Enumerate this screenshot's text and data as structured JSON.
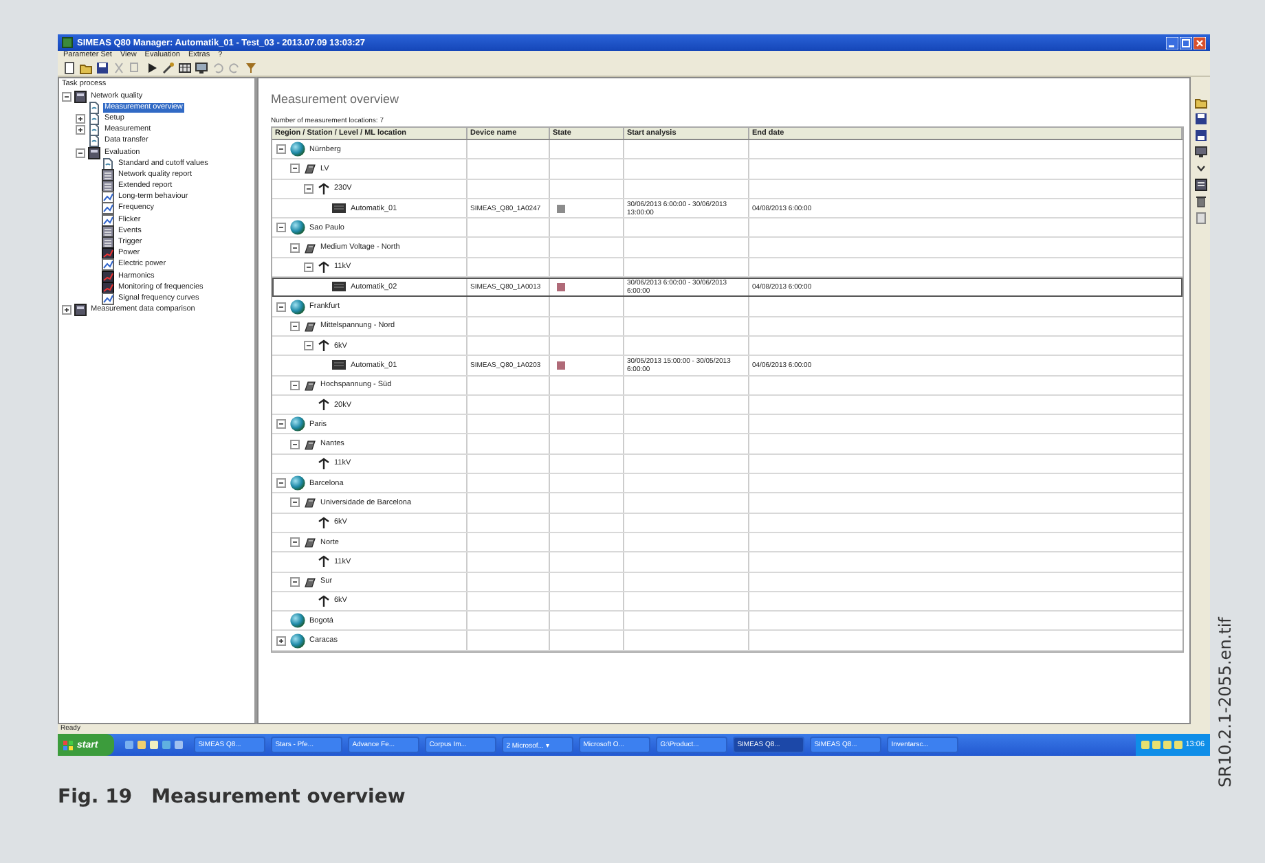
{
  "window": {
    "title": "SIMEAS Q80 Manager: Automatik_01 - Test_03 - 2013.07.09 13:03:27"
  },
  "menu": [
    "Parameter Set",
    "View",
    "Evaluation",
    "Extras",
    "?"
  ],
  "task_tree": {
    "title": "Task process",
    "items": [
      {
        "label": "Network quality",
        "kind": "folder",
        "expanded": true,
        "selected": false,
        "children": [
          {
            "label": "Measurement overview",
            "kind": "page",
            "selected": true
          },
          {
            "label": "Setup",
            "kind": "page",
            "expanded": false,
            "selected": false
          },
          {
            "label": "Measurement",
            "kind": "page",
            "expanded": false,
            "selected": false
          },
          {
            "label": "Data transfer",
            "kind": "page",
            "selected": false
          },
          {
            "label": "Evaluation",
            "kind": "folder",
            "expanded": true,
            "selected": false,
            "children": [
              {
                "label": "Standard and cutoff values",
                "kind": "page",
                "selected": false
              },
              {
                "label": "Network quality report",
                "kind": "report",
                "selected": false
              },
              {
                "label": "Extended report",
                "kind": "report",
                "selected": false
              },
              {
                "label": "Long-term behaviour",
                "kind": "chart",
                "selected": false
              },
              {
                "label": "Frequency",
                "kind": "chart",
                "selected": false
              },
              {
                "label": "Flicker",
                "kind": "chart",
                "selected": false
              },
              {
                "label": "Events",
                "kind": "report",
                "selected": false
              },
              {
                "label": "Trigger",
                "kind": "report",
                "selected": false
              },
              {
                "label": "Power",
                "kind": "power",
                "selected": false
              },
              {
                "label": "Electric power",
                "kind": "chart",
                "selected": false
              },
              {
                "label": "Harmonics",
                "kind": "power",
                "selected": false
              },
              {
                "label": "Monitoring of frequencies",
                "kind": "power",
                "selected": false
              },
              {
                "label": "Signal frequency curves",
                "kind": "chart",
                "selected": false
              }
            ]
          }
        ]
      },
      {
        "label": "Measurement data comparison",
        "kind": "folder",
        "expanded": false,
        "selected": false
      }
    ]
  },
  "main": {
    "title": "Measurement overview",
    "count_label": "Number of measurement locations: 7",
    "columns": [
      "Region / Station / Level / ML location",
      "Device name",
      "State",
      "Start analysis",
      "End date"
    ],
    "rows": [
      {
        "kind": "region",
        "label": "Nürnberg",
        "expanded": true,
        "selected": false,
        "children": [
          {
            "kind": "station",
            "label": "LV",
            "expanded": true,
            "selected": false,
            "children": [
              {
                "kind": "level",
                "label": "230V",
                "expanded": true,
                "selected": false,
                "children": [
                  {
                    "kind": "device",
                    "label": "Automatik_01",
                    "device": "SIMEAS_Q80_1A0247",
                    "color": "#8c8c8c",
                    "start": "30/06/2013 6:00:00 - 30/06/2013 13:00:00",
                    "end": "04/08/2013 6:00:00",
                    "selected": false
                  }
                ]
              }
            ]
          }
        ]
      },
      {
        "kind": "region",
        "label": "Sao Paulo",
        "expanded": true,
        "selected": false,
        "children": [
          {
            "kind": "station",
            "label": "Medium Voltage - North",
            "expanded": true,
            "selected": false,
            "children": [
              {
                "kind": "level",
                "label": "11kV",
                "expanded": true,
                "selected": false,
                "children": [
                  {
                    "kind": "device",
                    "label": "Automatik_02",
                    "device": "SIMEAS_Q80_1A0013",
                    "color": "#b06a78",
                    "start": "30/06/2013 6:00:00 - 30/06/2013 6:00:00",
                    "end": "04/08/2013 6:00:00",
                    "selected": true
                  }
                ]
              }
            ]
          }
        ]
      },
      {
        "kind": "region",
        "label": "Frankfurt",
        "expanded": true,
        "selected": false,
        "children": [
          {
            "kind": "station",
            "label": "Mittelspannung - Nord",
            "expanded": true,
            "selected": false,
            "children": [
              {
                "kind": "level",
                "label": "6kV",
                "expanded": true,
                "selected": false,
                "children": [
                  {
                    "kind": "device",
                    "label": "Automatik_01",
                    "device": "SIMEAS_Q80_1A0203",
                    "color": "#b06a78",
                    "start": "30/05/2013 15:00:00 - 30/05/2013 6:00:00",
                    "end": "04/06/2013 6:00:00",
                    "selected": false
                  }
                ]
              }
            ]
          },
          {
            "kind": "station",
            "label": "Hochspannung - Süd",
            "expanded": true,
            "selected": false,
            "children": [
              {
                "kind": "level",
                "label": "20kV",
                "selected": false
              }
            ]
          }
        ]
      },
      {
        "kind": "region",
        "label": "Paris",
        "expanded": true,
        "selected": false,
        "children": [
          {
            "kind": "station",
            "label": "Nantes",
            "expanded": true,
            "selected": false,
            "children": [
              {
                "kind": "level",
                "label": "11kV",
                "selected": false
              }
            ]
          }
        ]
      },
      {
        "kind": "region",
        "label": "Barcelona",
        "expanded": true,
        "selected": false,
        "children": [
          {
            "kind": "station",
            "label": "Universidade de Barcelona",
            "expanded": true,
            "selected": false,
            "children": [
              {
                "kind": "level",
                "label": "6kV",
                "selected": false
              }
            ]
          },
          {
            "kind": "station",
            "label": "Norte",
            "expanded": true,
            "selected": false,
            "children": [
              {
                "kind": "level",
                "label": "11kV",
                "selected": false
              }
            ]
          },
          {
            "kind": "station",
            "label": "Sur",
            "expanded": true,
            "selected": false,
            "children": [
              {
                "kind": "level",
                "label": "6kV",
                "selected": false
              }
            ]
          }
        ]
      },
      {
        "kind": "region",
        "label": "Bogotá",
        "selected": false
      },
      {
        "kind": "region",
        "label": "Caracas",
        "expanded": false,
        "selected": false
      }
    ]
  },
  "status_bar": {
    "text": "Ready"
  },
  "taskbar": {
    "start": "start",
    "tasks": [
      {
        "label": "SIMEAS Q8...",
        "selected": false
      },
      {
        "label": "Stars - Pfe...",
        "selected": false
      },
      {
        "label": "Advance Fe...",
        "selected": false
      },
      {
        "label": "Corpus Im...",
        "selected": false
      },
      {
        "label": "2 Microsof... ▾",
        "selected": false
      },
      {
        "label": "Microsoft O...",
        "selected": false
      },
      {
        "label": "G:\\Product...",
        "selected": false
      },
      {
        "label": "SIMEAS Q8...",
        "selected": true
      },
      {
        "label": "SIMEAS Q8...",
        "selected": false
      },
      {
        "label": "Inventarsc...",
        "selected": false
      }
    ],
    "clock": "13:06"
  },
  "caption": {
    "number": "Fig. 19",
    "text": "Measurement overview"
  },
  "file_label": "SR10.2.1-2055.en.tif"
}
